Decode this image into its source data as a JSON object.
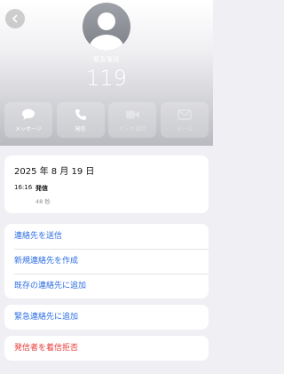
{
  "header": {
    "contact_name": "緊急電話",
    "contact_number": "119",
    "actions": [
      {
        "label": "メッセージ",
        "icon": "message-icon",
        "enabled": true
      },
      {
        "label": "発信",
        "icon": "phone-icon",
        "enabled": true
      },
      {
        "label": "ビデオ通話",
        "icon": "video-icon",
        "enabled": false
      },
      {
        "label": "メール",
        "icon": "mail-icon",
        "enabled": false
      }
    ]
  },
  "call_info": {
    "date": "2025 年 8 月 19 日",
    "time": "16:16",
    "type": "発信",
    "duration": "48 秒"
  },
  "links": {
    "share_contact": "連絡先を送信",
    "create_contact": "新規連絡先を作成",
    "add_existing": "既存の連絡先に追加",
    "add_emergency": "緊急連絡先に追加",
    "block_caller": "発信者を着信拒否"
  },
  "colors": {
    "link_blue": "#2f6fe3",
    "destructive_red": "#e53935",
    "background": "#efeff4"
  }
}
